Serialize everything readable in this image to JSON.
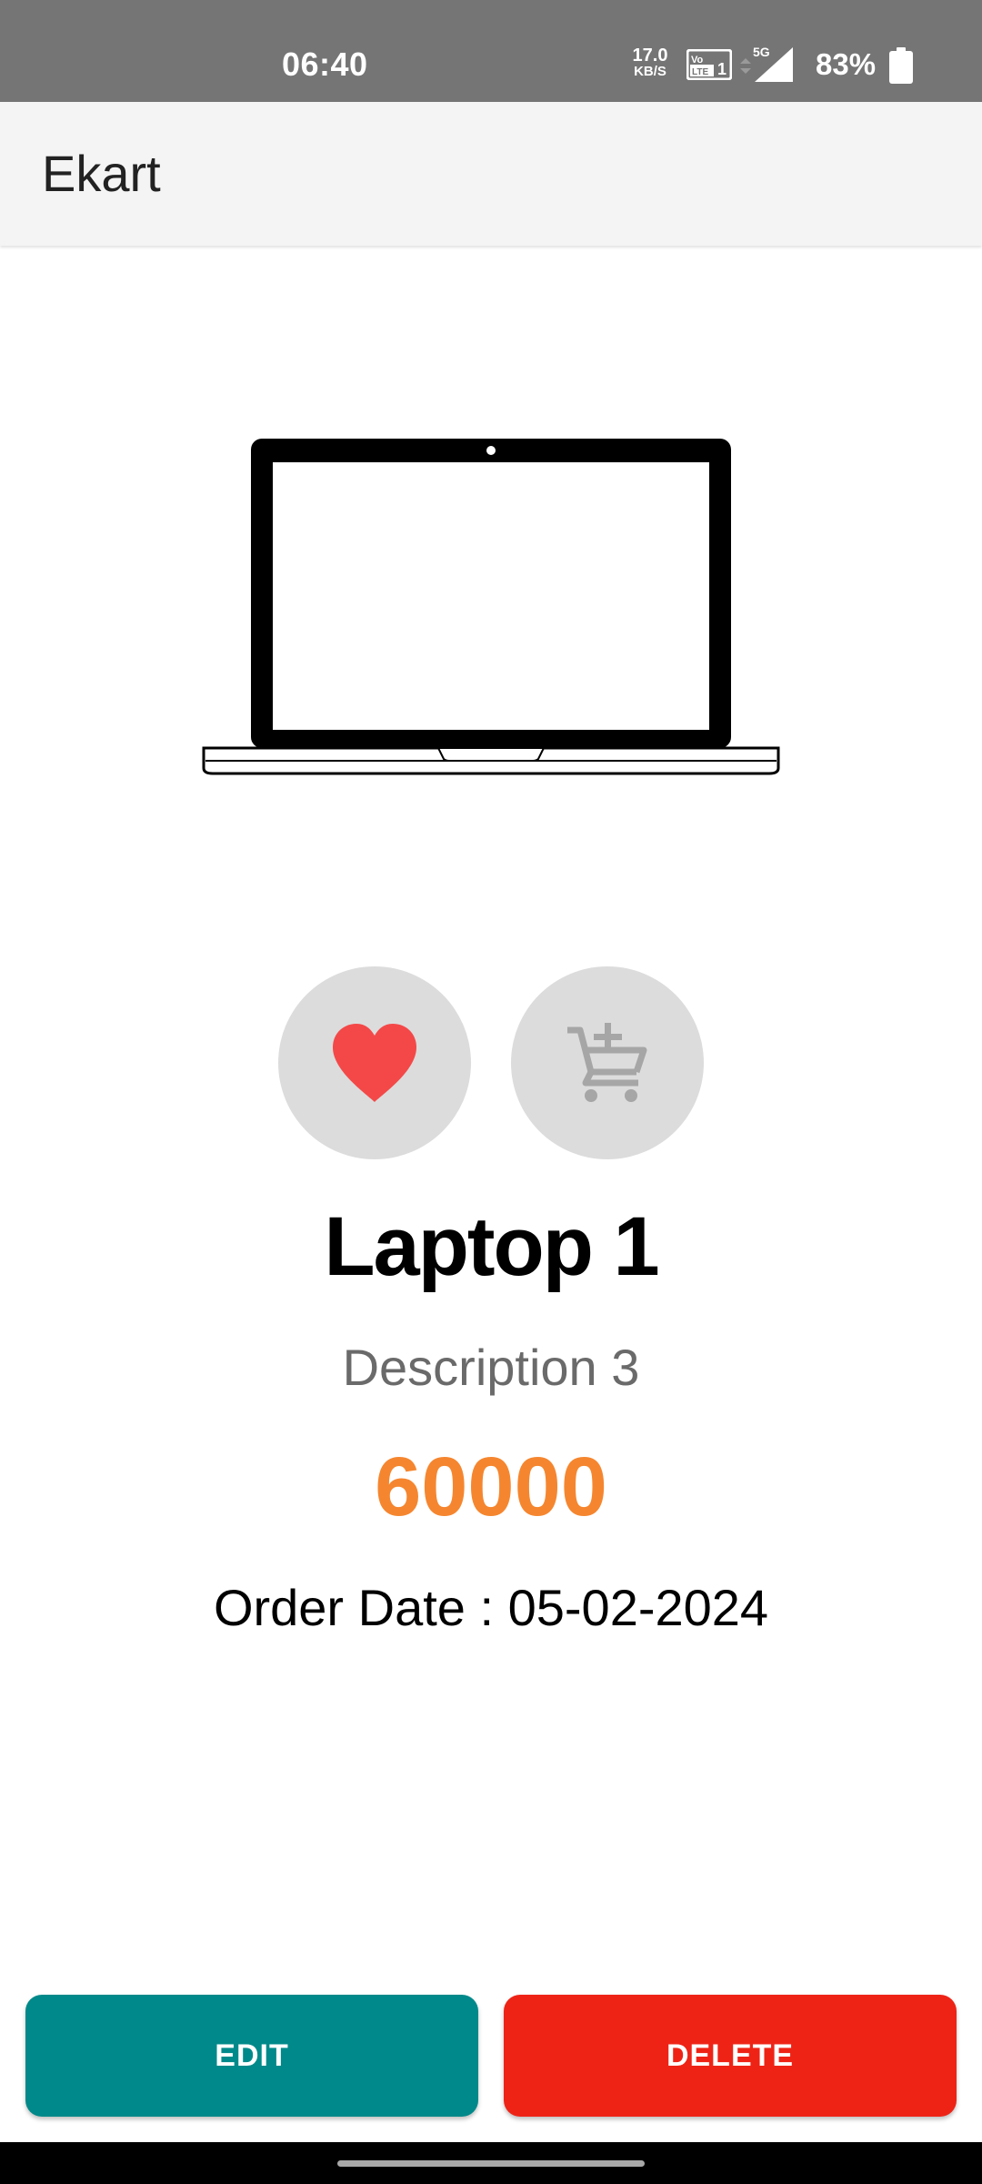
{
  "status_bar": {
    "time": "06:40",
    "network_speed_value": "17.0",
    "network_speed_unit": "KB/S",
    "volte_icon": "volte-lte-icon",
    "signal_icon": "signal-5g-icon",
    "signal_label": "5G",
    "battery_percent": "83%",
    "battery_icon": "battery-icon"
  },
  "app_bar": {
    "title": "Ekart"
  },
  "product": {
    "image_icon": "laptop-image",
    "name": "Laptop 1",
    "description": "Description 3",
    "price": "60000",
    "order_date": "Order Date : 05-02-2024"
  },
  "actions": {
    "favorite_icon": "heart-icon",
    "cart_icon": "add-to-cart-icon",
    "edit_label": "EDIT",
    "delete_label": "DELETE"
  },
  "colors": {
    "status_bar": "#757575",
    "app_bar": "#f4f4f4",
    "price": "#f5862f",
    "heart": "#f44848",
    "edit_button": "#00898a",
    "delete_button": "#ee2316",
    "round_button_bg": "#dcdcdc"
  }
}
